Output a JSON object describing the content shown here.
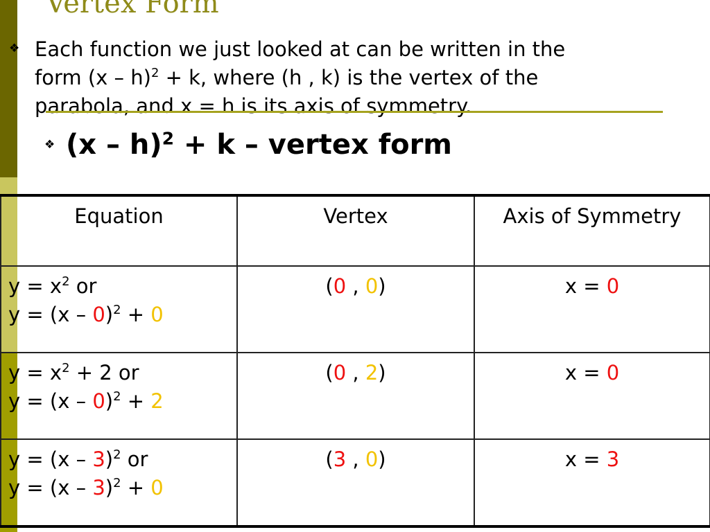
{
  "slide": {
    "title": "Vertex Form",
    "bullet_icon": "four-diamond-bullet",
    "paragraph": {
      "line1": "Each function we just looked at can be written in the",
      "line2_a": "form (x – h)",
      "line2_sup": "2",
      "line2_b": " + k, where (h , k) is the vertex of the",
      "line3": "parabola, and x = h is its axis of symmetry."
    },
    "subheading": {
      "a": "(x – h)",
      "sup": "2",
      "b": " + k – vertex form"
    }
  },
  "colors": {
    "sidebar_dark": "#6b6600",
    "sidebar_light": "#c9c65e",
    "sidebar_mid": "#a09e00",
    "title": "#8f8b1a",
    "h_value": "#ee1111",
    "k_value": "#f2c200"
  },
  "table": {
    "headers": [
      "Equation",
      "Vertex",
      "Axis of Symmetry"
    ],
    "rows": [
      {
        "eq1_a": "y = x",
        "eq1_sup": "2",
        "eq1_b": " or",
        "eq2_a": "y = (x – ",
        "h": "0",
        "eq2_sup": "2",
        "eq2_plus": " + ",
        "k": "0",
        "vertex_h": "0",
        "vertex_k": "0",
        "axis_prefix": "x = ",
        "axis_value": "0"
      },
      {
        "eq1_a": "y = x",
        "eq1_sup": "2",
        "eq1_b": " + 2 or",
        "eq2_a": "y = (x – ",
        "h": "0",
        "eq2_sup": "2",
        "eq2_plus": " + ",
        "k": "2",
        "vertex_h": "0",
        "vertex_k": "2",
        "axis_prefix": "x = ",
        "axis_value": "0"
      },
      {
        "eq1_a": "y = (x – ",
        "eq1_h": "3",
        "eq1_close": ")",
        "eq1_sup": "2",
        "eq1_b": " or",
        "eq2_a": "y = (x – ",
        "h": "3",
        "eq2_sup": "2",
        "eq2_plus": " + ",
        "k": "0",
        "vertex_h": "3",
        "vertex_k": "0",
        "axis_prefix": "x = ",
        "axis_value": "3"
      }
    ]
  }
}
